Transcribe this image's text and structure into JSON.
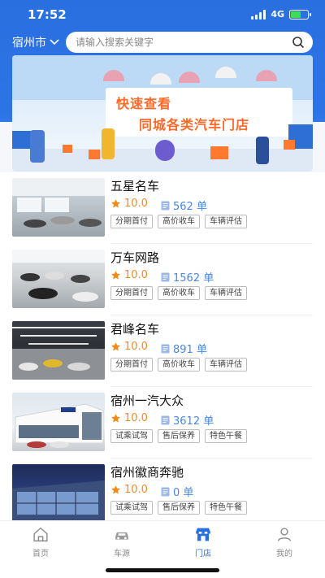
{
  "status": {
    "time": "17:52",
    "network": "4G"
  },
  "header": {
    "city": "宿州市",
    "search_placeholder": "请输入搜索关键字"
  },
  "banner": {
    "line1": "快速查看",
    "line2": "同城各类汽车门店"
  },
  "stores": [
    {
      "name": "五星名车",
      "rating": "10.0",
      "count": "562 单",
      "tags": [
        "分期首付",
        "高价收车",
        "车辆评估"
      ]
    },
    {
      "name": "万车网路",
      "rating": "10.0",
      "count": "1562 单",
      "tags": [
        "分期首付",
        "高价收车",
        "车辆评估"
      ]
    },
    {
      "name": "君峰名车",
      "rating": "10.0",
      "count": "891 单",
      "tags": [
        "分期首付",
        "高价收车",
        "车辆评估"
      ]
    },
    {
      "name": "宿州一汽大众",
      "rating": "10.0",
      "count": "3612 单",
      "tags": [
        "试乘试驾",
        "售后保养",
        "特色午餐"
      ]
    },
    {
      "name": "宿州徽商奔驰",
      "rating": "10.0",
      "count": "0 单",
      "tags": [
        "试乘试驾",
        "售后保养",
        "特色午餐"
      ]
    }
  ],
  "tabbar": [
    {
      "label": "首页",
      "icon": "home-icon"
    },
    {
      "label": "车源",
      "icon": "car-icon"
    },
    {
      "label": "门店",
      "icon": "store-icon",
      "active": true
    },
    {
      "label": "我的",
      "icon": "user-icon"
    }
  ],
  "colors": {
    "brand": "#2a6fe0",
    "rating": "#f08d1a",
    "count": "#4a87e6",
    "banner_text": "#ff6a2b"
  }
}
